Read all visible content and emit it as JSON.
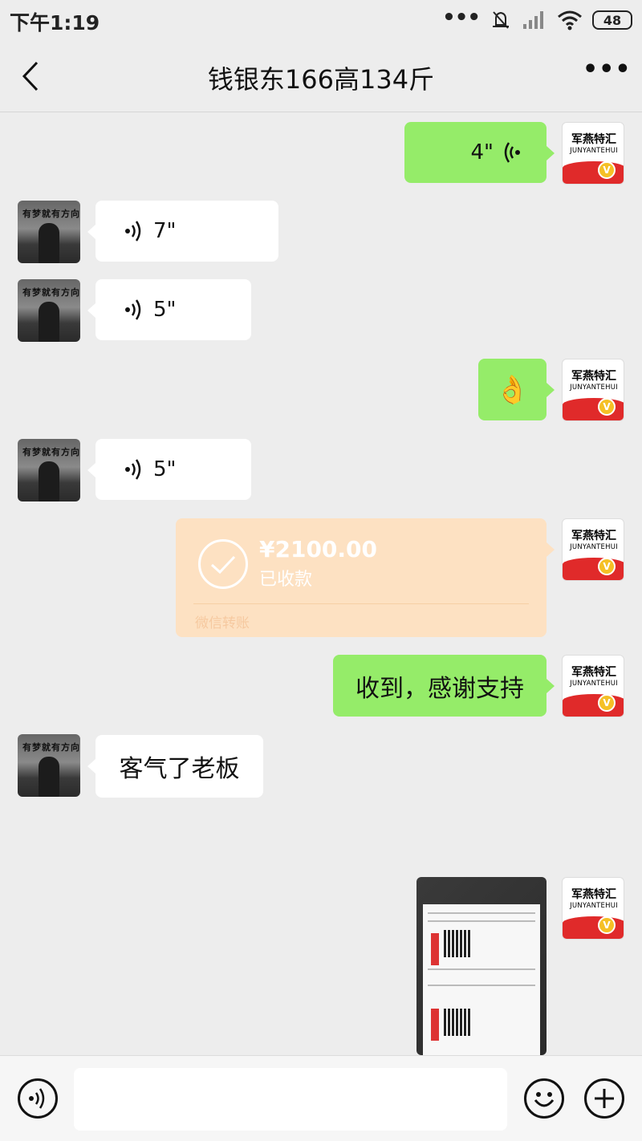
{
  "status_bar": {
    "time": "下午1:19",
    "battery": "48"
  },
  "header": {
    "title": "钱银东166高134斤"
  },
  "contact_avatar": {
    "caption": "有梦就有方向"
  },
  "my_avatar": {
    "brand": "军燕特汇",
    "brand_en": "JUNYANTEHUI",
    "badge": "V"
  },
  "messages": [
    {
      "type": "voice",
      "side": "right",
      "duration": "4\""
    },
    {
      "type": "voice",
      "side": "left",
      "duration": "7\""
    },
    {
      "type": "voice",
      "side": "left",
      "duration": "5\""
    },
    {
      "type": "emoji",
      "side": "right",
      "emoji": "👌"
    },
    {
      "type": "voice",
      "side": "left",
      "duration": "5\""
    },
    {
      "type": "transfer",
      "side": "right",
      "amount": "¥2100.00",
      "status": "已收款",
      "footer": "微信转账"
    },
    {
      "type": "text",
      "side": "right",
      "text": "收到，感谢支持"
    },
    {
      "type": "text",
      "side": "left",
      "text": "客气了老板"
    },
    {
      "type": "image",
      "side": "right",
      "description": "shipping labels photo"
    }
  ],
  "input": {
    "placeholder": ""
  },
  "colors": {
    "bg": "#ededed",
    "bubble_mine": "#95ec69",
    "bubble_other": "#ffffff",
    "transfer": "#fde1c2"
  }
}
